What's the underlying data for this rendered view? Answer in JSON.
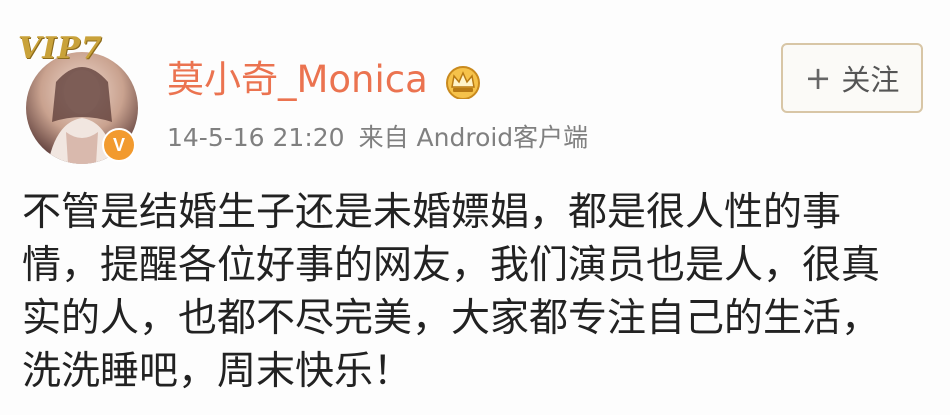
{
  "post": {
    "vip_label": "VIP7",
    "username": "莫小奇_Monica",
    "timestamp": "14-5-16 21:20",
    "source": "来自 Android客户端",
    "verified_mark": "V",
    "follow_plus": "+",
    "follow_label": "关注",
    "content_lines": [
      "不管是结婚生子还是未婚嫖娼，都是很人性的事",
      "情，提醒各位好事的网友，我们演员也是人，很真",
      "实的人，也都不尽完美，大家都专注自己的生活，",
      "洗洗睡吧，周末快乐！"
    ]
  },
  "colors": {
    "username": "#eb7350",
    "meta": "#808080",
    "verified": "#f29a2e",
    "crown": "#e8a93a",
    "follow_border": "#d8c6a6"
  },
  "icons": {
    "crown": "crown-icon",
    "verified": "verified-badge-icon",
    "vip": "vip-badge"
  }
}
